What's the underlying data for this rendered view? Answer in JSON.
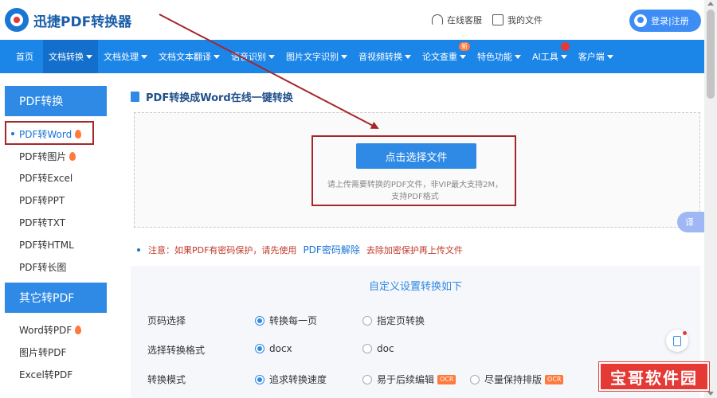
{
  "header": {
    "logo_text": "迅捷PDF转换器",
    "support_label": "在线客服",
    "files_label": "我的文件",
    "login_label": "登录|注册"
  },
  "nav": {
    "items": [
      {
        "label": "首页",
        "caret": false
      },
      {
        "label": "文档转换",
        "caret": true,
        "active": true
      },
      {
        "label": "文档处理",
        "caret": true
      },
      {
        "label": "文档文本翻译",
        "caret": true
      },
      {
        "label": "语音识别",
        "caret": true
      },
      {
        "label": "图片文字识别",
        "caret": true
      },
      {
        "label": "音视频转换",
        "caret": true
      },
      {
        "label": "论文查重",
        "caret": true,
        "badge": "新"
      },
      {
        "label": "特色功能",
        "caret": true
      },
      {
        "label": "AI工具",
        "caret": true,
        "hot": true
      },
      {
        "label": "客户端",
        "caret": true
      }
    ]
  },
  "sidebar": {
    "section1_title": "PDF转换",
    "section1_items": [
      {
        "label": "PDF转Word",
        "hot": true,
        "active": true
      },
      {
        "label": "PDF转图片",
        "hot": true
      },
      {
        "label": "PDF转Excel"
      },
      {
        "label": "PDF转PPT"
      },
      {
        "label": "PDF转TXT"
      },
      {
        "label": "PDF转HTML"
      },
      {
        "label": "PDF转长图"
      }
    ],
    "section2_title": "其它转PDF",
    "section2_items": [
      {
        "label": "Word转PDF",
        "hot": true
      },
      {
        "label": "图片转PDF"
      },
      {
        "label": "Excel转PDF"
      }
    ]
  },
  "main": {
    "title": "PDF转换成Word在线一键转换",
    "select_button": "点击选择文件",
    "hint_line1": "请上传需要转换的PDF文件，非VIP最大支持2M，",
    "hint_line2": "支持PDF格式",
    "translate_label": "译",
    "notice_prefix": "注意：如果PDF有密码保护，请先使用",
    "notice_link": "PDF密码解除",
    "notice_suffix": "去除加密保护再上传文件"
  },
  "settings": {
    "title": "自定义设置转换如下",
    "rows": [
      {
        "label": "页码选择",
        "options": [
          {
            "label": "转换每一页",
            "selected": true
          },
          {
            "label": "指定页转换",
            "selected": false
          }
        ]
      },
      {
        "label": "选择转换格式",
        "options": [
          {
            "label": "docx",
            "selected": true
          },
          {
            "label": "doc",
            "selected": false
          }
        ]
      },
      {
        "label": "转换模式",
        "options": [
          {
            "label": "追求转换速度",
            "selected": true
          },
          {
            "label": "易于后续编辑",
            "selected": false,
            "tag": "OCR"
          },
          {
            "label": "尽量保持排版",
            "selected": false,
            "tag": "OCR"
          }
        ]
      }
    ]
  },
  "watermark": "宝哥软件园",
  "colors": {
    "nav_blue": "#1c86e8",
    "accent": "#2f8ae6",
    "annotation_red": "#a4282b",
    "notice_red": "#c0392b"
  }
}
